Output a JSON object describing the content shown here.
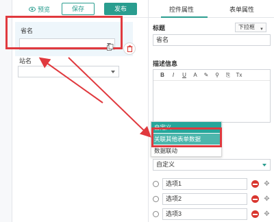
{
  "toolbar": {
    "preview_label": "预览",
    "save_label": "保存",
    "publish_label": "发布"
  },
  "canvas": {
    "fields": [
      {
        "label": "省名"
      },
      {
        "label": "站名"
      }
    ]
  },
  "panel": {
    "tabs": [
      {
        "label": "控件属性",
        "active": true
      },
      {
        "label": "表单属性",
        "active": false
      }
    ],
    "title_section": "标题",
    "field_type": "下拉框",
    "title_value": "省名",
    "desc_section": "描述信息",
    "editor_buttons": [
      "B",
      "I",
      "U",
      "A",
      "✎",
      "⚲",
      "⎘",
      "Tx"
    ],
    "source_value": "自定义",
    "options": [
      {
        "label": "选项1"
      },
      {
        "label": "选项2"
      },
      {
        "label": "选项3"
      }
    ]
  },
  "popup": {
    "items": [
      {
        "label": "自定义",
        "state": "highlighted"
      },
      {
        "label": "关联其他表单数据",
        "state": "hovered"
      },
      {
        "label": "数据联动",
        "state": "normal"
      }
    ]
  },
  "colors": {
    "accent": "#2a9d8f",
    "annotation_red": "#e0393e",
    "popup_highlight": "#26a69a"
  },
  "icons": [
    "eye-icon",
    "copy-icon",
    "trash-icon",
    "chevron-down-icon",
    "remove-circle-icon",
    "move-icon"
  ]
}
